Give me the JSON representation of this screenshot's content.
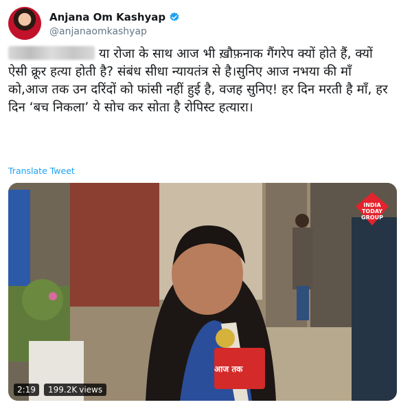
{
  "author": {
    "display_name": "Anjana Om Kashyap",
    "handle": "@anjanaomkashyap"
  },
  "tweet_text": "या रोजा के साथ आज भी ख़ौफ़नाक गैंगरेप क्यों होते हैं, क्यों ऐसी क्रूर हत्या होती है? संबंध सीधा न्यायतंत्र से है।सुनिए आज नभया की माँ को,आज तक उन दरिंदों को फांसी नहीं हुई है, वजह सुनिए! हर दिन मरती है माँ, हर दिन ‘बच निकला’ ये सोच कर सोता है रोपिस्ट हत्यारा।",
  "translate_label": "Translate Tweet",
  "video": {
    "duration": "2:19",
    "views_count": "199.2K",
    "views_label": "views",
    "watermark": "INDIA TODAY GROUP",
    "mic_logo": "आज तक"
  },
  "colors": {
    "link": "#1da1f2",
    "verified": "#1da1f2",
    "text": "#14171a",
    "secondary": "#657786"
  }
}
